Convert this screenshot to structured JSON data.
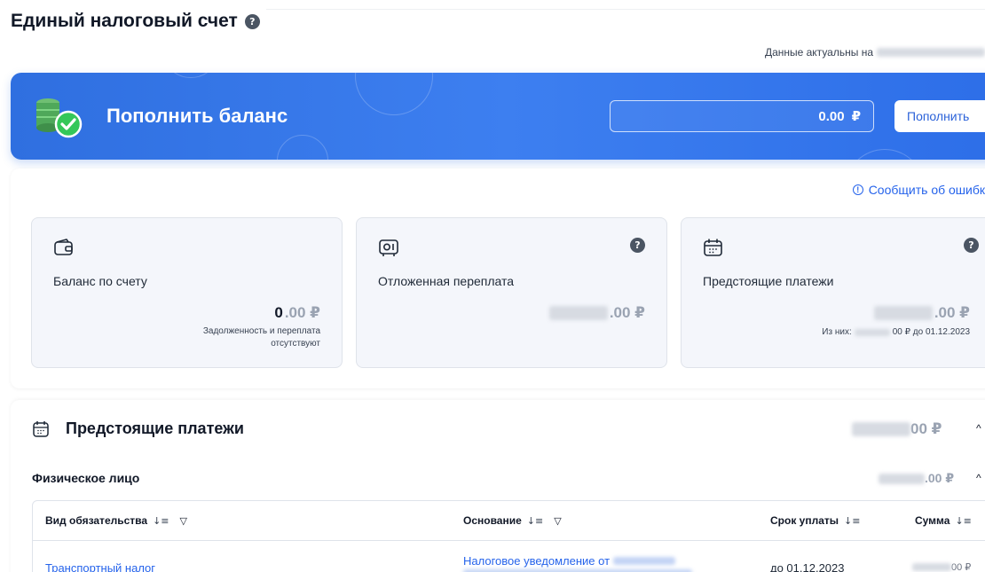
{
  "header": {
    "title": "Единый налоговый счет",
    "help": "?",
    "actual_label": "Данные актуальны на"
  },
  "banner": {
    "title": "Пополнить баланс",
    "amount": "0.00",
    "currency": "₽",
    "button": "Пополнить"
  },
  "report_error": "Сообщить об ошибк",
  "cards": [
    {
      "icon": "wallet-icon",
      "label": "Баланс по счету",
      "value_strong": "0",
      "value_rest": ".00 ₽",
      "note": "Задолженность и переплата\nотсутствуют"
    },
    {
      "icon": "safe-icon",
      "label": "Отложенная переплата",
      "value_rest": ".00 ₽",
      "help": "?"
    },
    {
      "icon": "calendar-icon",
      "label": "Предстоящие платежи",
      "value_rest": ".00 ₽",
      "help": "?",
      "note_prefix": "Из них:",
      "note_suffix": "00 ₽ до 01.12.2023"
    }
  ],
  "section": {
    "title": "Предстоящие платежи",
    "total_suffix": "00 ₽",
    "person_label": "Физическое лицо",
    "person_total_suffix": ".00 ₽"
  },
  "table": {
    "columns": [
      "Вид обязательства",
      "Основание",
      "Срок уплаты",
      "Сумма"
    ],
    "rows": [
      {
        "type": "Транспортный налог",
        "basis_prefix": "Налоговое уведомление от",
        "due": "до 01.12.2023",
        "amount_suffix": "00 ₽"
      }
    ]
  },
  "colors": {
    "banner_blue": "#2f6fe0",
    "link_blue": "#2563eb",
    "card_bg": "#f4f6fb"
  }
}
